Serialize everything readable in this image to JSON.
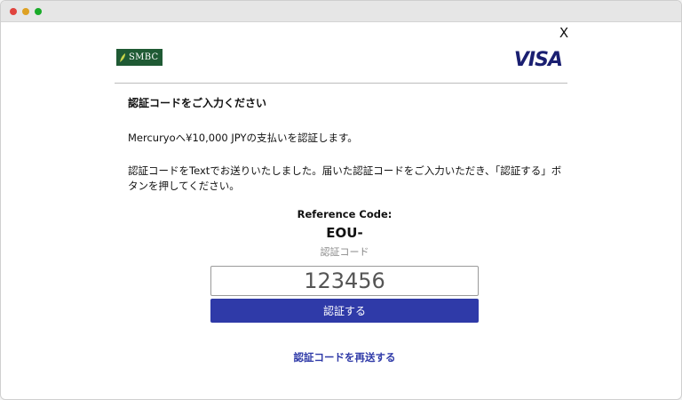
{
  "window": {
    "close_label": "X"
  },
  "header": {
    "smbc_label": "SMBC",
    "visa_label": "VISA"
  },
  "content": {
    "heading": "認証コードをご入力ください",
    "payment_text": "Mercuryoへ¥10,000 JPYの支払いを認証します。",
    "instruction_text": "認証コードをTextでお送りいたしました。届いた認証コードをご入力いただき、「認証する」ボタンを押してください。"
  },
  "form": {
    "reference_label": "Reference Code:",
    "reference_value": "EOU-",
    "code_label": "認証コード",
    "code_value": "123456",
    "submit_label": "認証する",
    "resend_label": "認証コードを再送する"
  },
  "colors": {
    "accent": "#2f3aa8",
    "smbc_green": "#1f5a34",
    "visa_blue": "#1a1f71"
  }
}
